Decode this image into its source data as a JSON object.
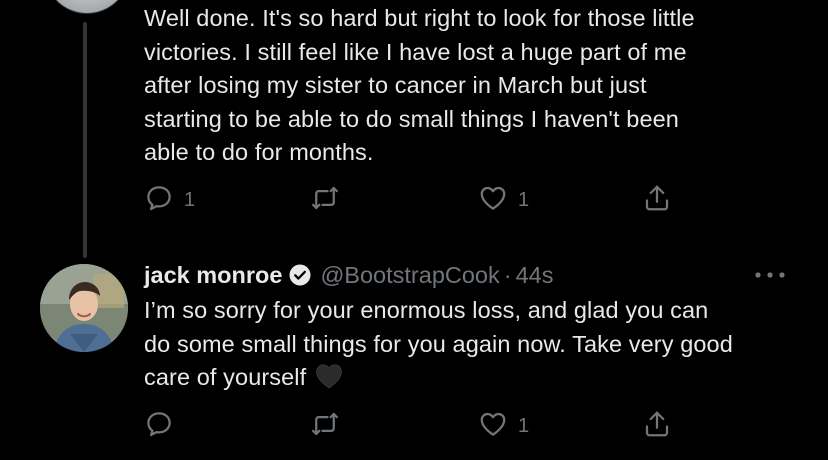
{
  "previous_tweet": {
    "text_lines": [
      "Well done. It's so hard but right to look for those little",
      "victories. I still feel like I have lost a huge part of me",
      "after losing my sister to cancer in March but just",
      "starting to be able to do small things I haven't been",
      "able to do for months."
    ],
    "reply_count": "1",
    "retweet_count": "",
    "like_count": "1"
  },
  "reply_tweet": {
    "display_name": "jack monroe",
    "handle": "@BootstrapCook",
    "separator": "·",
    "time": "44s",
    "text_lines": [
      "I’m so sorry for your enormous loss, and glad you can",
      "do some small things for you again now. Take very good",
      "care of yourself"
    ],
    "emoji": "black-heart",
    "reply_count": "",
    "retweet_count": "",
    "like_count": "1"
  },
  "icons": [
    "reply-icon",
    "retweet-icon",
    "like-icon",
    "share-icon",
    "verified-badge-icon",
    "more-options-icon"
  ],
  "colors": {
    "background": "#000000",
    "text": "#e7e9ea",
    "muted": "#71767b",
    "thread_line": "#333639"
  }
}
